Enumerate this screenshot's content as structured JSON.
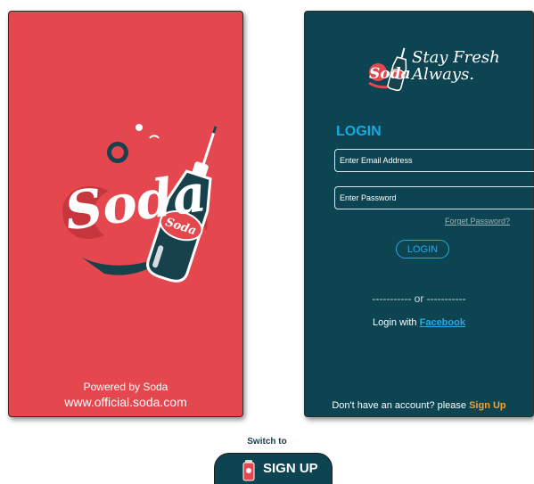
{
  "splash": {
    "logo_text": "Soda",
    "bottle_label": "Soda",
    "powered_by": "Powered by Soda",
    "website": "www.official.soda.com"
  },
  "login": {
    "brand_logo_text": "Soda",
    "tagline_line1": "Stay Fresh",
    "tagline_line2": "Always.",
    "title": "LOGIN",
    "email_placeholder": "Enter Email Address",
    "password_placeholder": "Enter Password",
    "forget_password": "Forget Password?",
    "login_button": "LOGIN",
    "or_divider": "----------- or -----------",
    "login_with": "Login with ",
    "facebook": "Facebook",
    "no_account": "Don't have an account? please ",
    "sign_up": "Sign Up"
  },
  "switch": {
    "label": "Switch to",
    "button": "SIGN UP"
  },
  "colors": {
    "splash_bg": "#e4474d",
    "login_bg": "#0c4451",
    "accent_blue": "#1aa7e0",
    "sign_up_orange": "#f0a33b"
  },
  "icons": [
    "soda-bottle-icon",
    "soda-can-icon"
  ]
}
